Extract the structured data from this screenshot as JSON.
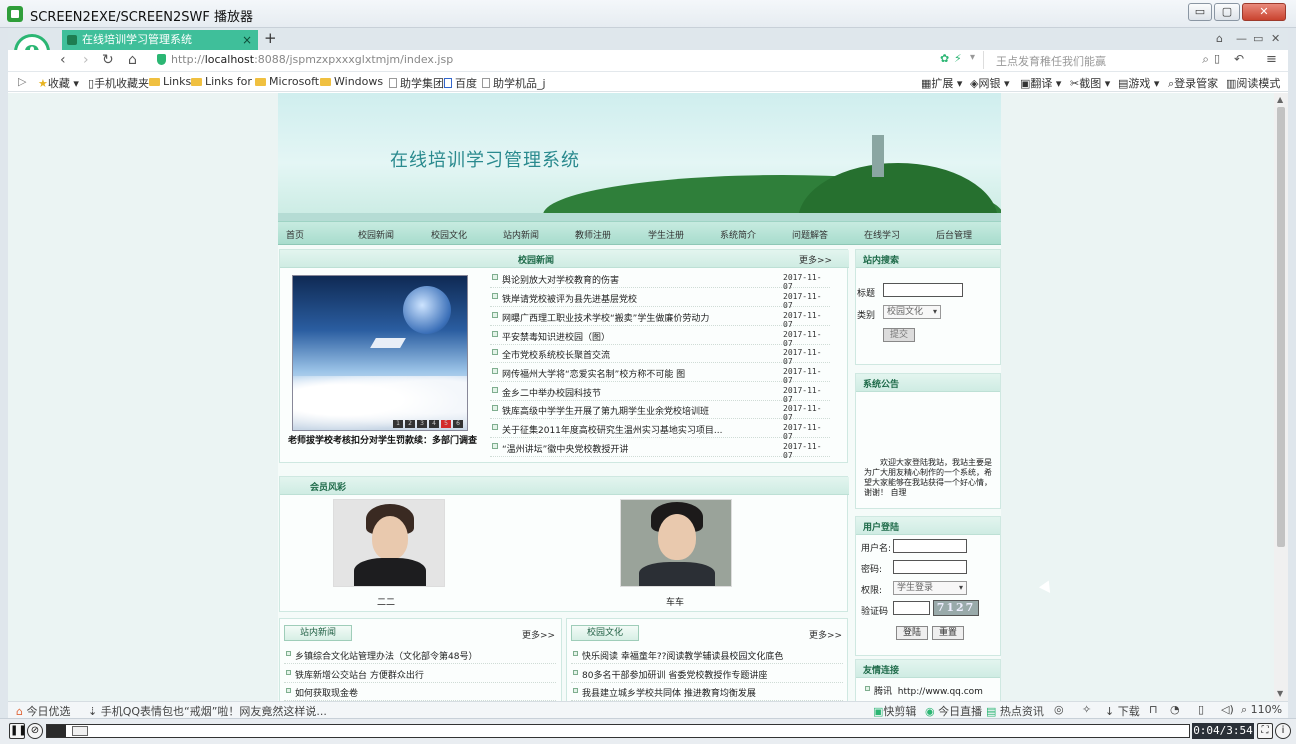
{
  "app": {
    "title": "SCREEN2EXE/SCREEN2SWF 播放器",
    "controls": [
      "▭",
      "▢",
      "✕"
    ]
  },
  "browser": {
    "tab_title": "在线培训学习管理系统",
    "tab_close": "×",
    "new_tab": "+",
    "url_host": "localhost",
    "url_prefix": "http://",
    "url_rest": ":8088/jspmzxpxxxglxtmjm/index.jsp",
    "search_placeholder": "王点发育稚任我们能赢",
    "bookmarks": [
      "收藏",
      "手机收藏夹",
      "Links",
      "Links for",
      "Microsoft",
      "Windows",
      "助学集团",
      "百度",
      "助学机品_j"
    ],
    "toolbar_right": [
      "扩展",
      "网银",
      "翻译",
      "截图",
      "游戏",
      "登录管家",
      "阅读模式"
    ]
  },
  "site": {
    "title": "在线培训学习管理系统",
    "menu": [
      "首页",
      "校园新闻",
      "校园文化",
      "站内新闻",
      "教师注册",
      "学生注册",
      "系统简介",
      "问题解答",
      "在线学习",
      "后台管理"
    ],
    "campus_news": {
      "title": "校园新闻",
      "more": "更多>>",
      "photo_caption": "老师拔学校考核扣分对学生罚款续：多部门调查",
      "slide_numbers": [
        "1",
        "2",
        "3",
        "4",
        "5",
        "6"
      ],
      "items": [
        {
          "title": "舆论别放大对学校教育的伤害",
          "date": "2017-11-07"
        },
        {
          "title": "铁岸请党校被评为县先进基层党校",
          "date": "2017-11-07"
        },
        {
          "title": "网曝广西理工职业技术学校“搬卖”学生做廉价劳动力",
          "date": "2017-11-07"
        },
        {
          "title": "平安禁毒知识进校园（图）",
          "date": "2017-11-07"
        },
        {
          "title": "全市党校系统校长聚首交流",
          "date": "2017-11-07"
        },
        {
          "title": "网传福州大学将“恋爱实名制”校方称不可能 图",
          "date": "2017-11-07"
        },
        {
          "title": "金乡二中举办校园科技节",
          "date": "2017-11-07"
        },
        {
          "title": "铁库高级中学学生开展了第九期学生业余党校培训班",
          "date": "2017-11-07"
        },
        {
          "title": "关于征集2011年度高校研究生温州实习基地实习项目...",
          "date": "2017-11-07"
        },
        {
          "title": "“温州讲坛”徽中央党校教授开讲",
          "date": "2017-11-07"
        }
      ]
    },
    "members": {
      "title": "会员风彩",
      "list": [
        {
          "name": "二二"
        },
        {
          "name": "车车"
        }
      ]
    },
    "station_news": {
      "title": "站内新闻",
      "more": "更多>>",
      "items": [
        "乡镇综合文化站管理办法（文化部令第48号）",
        "铁库新增公交站台 方便群众出行",
        "如何获取现金卷"
      ]
    },
    "campus_culture": {
      "title": "校园文化",
      "more": "更多>>",
      "items": [
        "快乐阅读 幸福童年??阅读教学辅读县校园文化底色",
        "80多名干部参加研训 省委党校教授作专题讲座",
        "我县建立城乡学校共同体 推进教育均衡发展"
      ]
    },
    "site_search": {
      "title": "站内搜索",
      "label_title": "标题",
      "label_category": "类别",
      "category_value": "校园文化",
      "submit": "提交"
    },
    "announcement": {
      "title": "系统公告",
      "text": "欢迎大家登陆我站，我站主要是为广大朋友精心制作的一个系统，希望大家能够在我站获得一个好心情，谢谢！ 自理"
    },
    "login": {
      "title": "用户登陆",
      "username_label": "用户名:",
      "password_label": "密码:",
      "role_label": "权限:",
      "role_value": "学生登录",
      "captcha_label": "验证码",
      "captcha_value": "7127",
      "login_button": "登陆",
      "reset_button": "重置"
    },
    "links": {
      "title": "友情连接",
      "items": [
        {
          "name": "腾讯",
          "url": "http://www.qq.com"
        }
      ]
    }
  },
  "statusbar": {
    "left": [
      "今日优选",
      "手机QQ表情包也“戒烟”啦！网友竟然这样说..."
    ],
    "right": [
      "快剪辑",
      "今日直播",
      "热点资讯",
      "下载",
      "110%"
    ]
  },
  "player": {
    "time": "0:04/3:54",
    "progress": 0.017
  }
}
